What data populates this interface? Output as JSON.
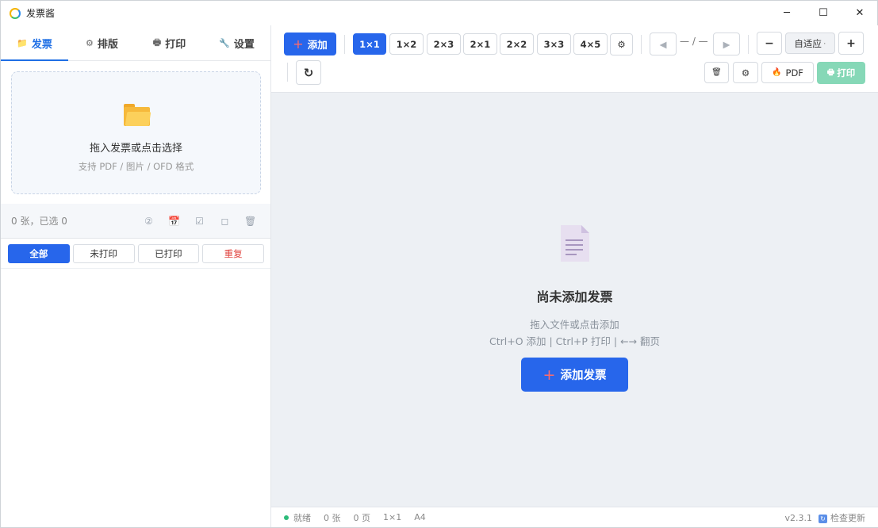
{
  "window": {
    "title": "发票酱",
    "controls": {
      "minimize": "─",
      "maximize": "☐",
      "close": "✕"
    }
  },
  "sidebar": {
    "tabs": [
      {
        "label": "发票",
        "icon": "folder-icon",
        "glyph": "📁"
      },
      {
        "label": "排版",
        "icon": "gear-icon",
        "glyph": "⚙"
      },
      {
        "label": "打印",
        "icon": "printer-icon",
        "glyph": "🖶"
      },
      {
        "label": "设置",
        "icon": "wrench-icon",
        "glyph": "🔧"
      }
    ],
    "dropzone": {
      "title": "拖入发票或点击选择",
      "subtitle": "支持 PDF / 图片 / OFD 格式"
    },
    "count_text": "0 张，已选 0",
    "count_icons": [
      {
        "name": "number-icon",
        "glyph": "②"
      },
      {
        "name": "calendar-icon",
        "glyph": "📅"
      },
      {
        "name": "check-all-icon",
        "glyph": "☑"
      },
      {
        "name": "uncheck-icon",
        "glyph": "◻"
      },
      {
        "name": "trash-icon",
        "glyph": "🗑"
      }
    ],
    "filters": [
      "全部",
      "未打印",
      "已打印",
      "重复"
    ]
  },
  "toolbar": {
    "add_label": "添加",
    "add_plus": "+",
    "layouts": [
      "1×1",
      "1×2",
      "2×3",
      "2×1",
      "2×2",
      "3×3",
      "4×5"
    ],
    "settings_glyph": "⚙",
    "prev_glyph": "◀",
    "next_glyph": "▶",
    "page_indicator": "— / —",
    "zoom_out": "−",
    "zoom_value": "自适应",
    "zoom_caret": "·",
    "zoom_in": "+",
    "refresh_glyph": "↻",
    "delete_glyph": "🗑",
    "config_glyph": "⚙",
    "pdf_label": "PDF",
    "pdf_icon": "🔥",
    "print_label": "打印",
    "print_icon": "🖶"
  },
  "empty_state": {
    "title": "尚未添加发票",
    "line1": "拖入文件或点击添加",
    "line2": "Ctrl+O 添加 | Ctrl+P 打印 | ←→ 翻页",
    "button_label": "添加发票",
    "button_plus": "+"
  },
  "status_bar": {
    "state": "就绪",
    "count": "0 张",
    "pages": "0 页",
    "layout": "1×1",
    "paper": "A4",
    "version": "v2.3.1",
    "update_label": "检查更新",
    "update_icon": "↻"
  },
  "colors": {
    "accent": "#2766eb",
    "print_disabled": "#86d8b7",
    "status_ok": "#2dbb7a",
    "duplicate": "#e0443f"
  }
}
